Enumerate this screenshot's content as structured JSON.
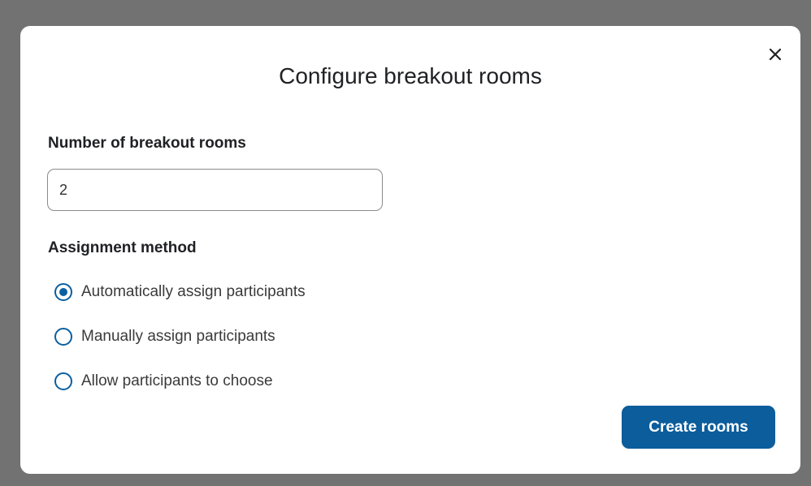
{
  "dialog": {
    "title": "Configure breakout rooms",
    "close_icon": "close-icon",
    "rooms_label": "Number of breakout rooms",
    "rooms_value": "2",
    "method_label": "Assignment method",
    "options": [
      {
        "label": "Automatically assign participants",
        "selected": true
      },
      {
        "label": "Manually assign participants",
        "selected": false
      },
      {
        "label": "Allow participants to choose",
        "selected": false
      }
    ],
    "create_label": "Create rooms"
  },
  "colors": {
    "accent": "#0b5d9c",
    "overlay": "#727272"
  }
}
